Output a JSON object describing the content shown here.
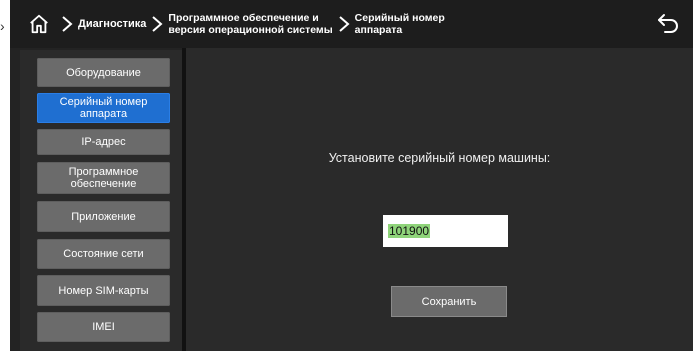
{
  "header": {
    "breadcrumbs": [
      "Диагностика",
      "Программное обеспечение и\nверсия операционной системы",
      "Серийный номер\nаппарата"
    ]
  },
  "sidebar": {
    "items": [
      {
        "label": "Оборудование",
        "active": false
      },
      {
        "label": "Серийный номер\nаппарата",
        "active": true
      },
      {
        "label": "IP-адрес",
        "active": false
      },
      {
        "label": "Программное\nобеспечение",
        "active": false
      },
      {
        "label": "Приложение",
        "active": false
      },
      {
        "label": "Состояние сети",
        "active": false
      },
      {
        "label": "Номер SIM-карты",
        "active": false
      },
      {
        "label": "IMEI",
        "active": false
      }
    ]
  },
  "main": {
    "prompt": "Установите серийный номер машины:",
    "serial_value": "101900",
    "save_label": "Сохранить"
  },
  "colors": {
    "accent": "#1f6fd1",
    "button": "#6b6b6b",
    "background": "#2a2a2a",
    "selection": "#8fd47a"
  },
  "icons": {
    "home": "home-icon",
    "separator": "chevron-right-icon",
    "back": "back-arrow-icon"
  }
}
